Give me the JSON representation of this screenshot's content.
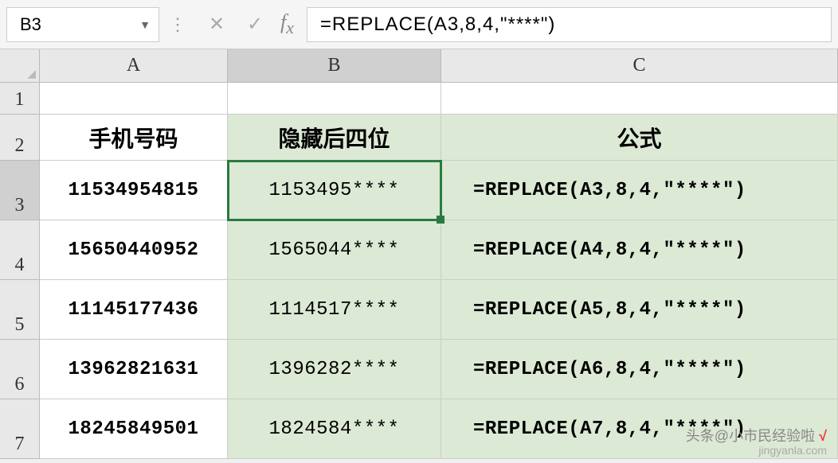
{
  "formula_bar": {
    "name_box": "B3",
    "formula": "=REPLACE(A3,8,4,\"****\")"
  },
  "columns": [
    "A",
    "B",
    "C"
  ],
  "row_numbers": [
    "1",
    "2",
    "3",
    "4",
    "5",
    "6",
    "7"
  ],
  "selected_cell": "B3",
  "headers": {
    "col_a": "手机号码",
    "col_b": "隐藏后四位",
    "col_c": "公式"
  },
  "rows": [
    {
      "phone": "11534954815",
      "masked": "1153495****",
      "formula": "=REPLACE(A3,8,4,\"****\")"
    },
    {
      "phone": "15650440952",
      "masked": "1565044****",
      "formula": "=REPLACE(A4,8,4,\"****\")"
    },
    {
      "phone": "11145177436",
      "masked": "1114517****",
      "formula": "=REPLACE(A5,8,4,\"****\")"
    },
    {
      "phone": "13962821631",
      "masked": "1396282****",
      "formula": "=REPLACE(A6,8,4,\"****\")"
    },
    {
      "phone": "18245849501",
      "masked": "1824584****",
      "formula": "=REPLACE(A7,8,4,\"****\")"
    }
  ],
  "watermark": {
    "text": "头条@小市民经验啦",
    "sub": "jingyanla.com",
    "check": "√"
  }
}
